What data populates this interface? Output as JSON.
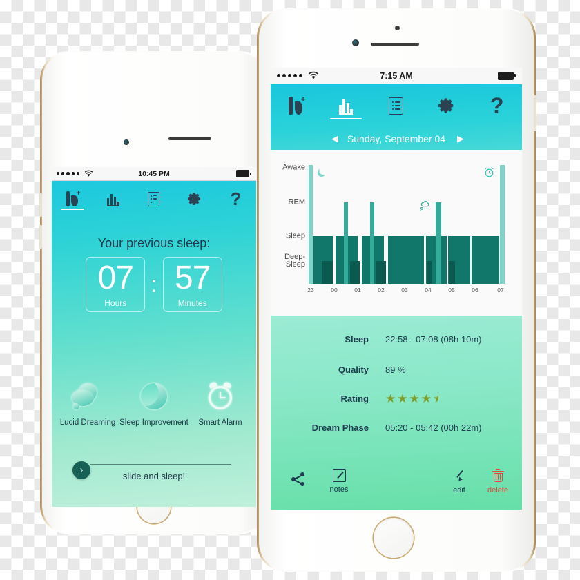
{
  "left_phone": {
    "status_bar": {
      "signal_dots": 5,
      "wifi": "wifi-icon",
      "time": "10:45 PM",
      "battery": "battery-full-icon"
    },
    "tabs": [
      {
        "id": "home",
        "icon": "b-plus-logo-icon",
        "active": true
      },
      {
        "id": "stats",
        "icon": "bar-chart-icon",
        "active": false
      },
      {
        "id": "list",
        "icon": "list-icon",
        "active": false
      },
      {
        "id": "settings",
        "icon": "gear-icon",
        "active": false
      },
      {
        "id": "help",
        "icon": "question-mark-icon",
        "label": "?",
        "active": false
      }
    ],
    "title": "Your previous sleep:",
    "counters": {
      "hours_value": "07",
      "hours_label": "Hours",
      "separator": ":",
      "minutes_value": "57",
      "minutes_label": "Minutes"
    },
    "features": [
      {
        "icon": "thought-cloud-icon",
        "label": "Lucid Dreaming"
      },
      {
        "icon": "moon-icon",
        "label": "Sleep Improvement"
      },
      {
        "icon": "alarm-clock-icon",
        "label": "Smart Alarm"
      }
    ],
    "slider": {
      "handle_glyph": "›",
      "label": "slide and sleep!"
    }
  },
  "right_phone": {
    "status_bar": {
      "signal_dots": 5,
      "wifi": "wifi-icon",
      "time": "7:15 AM",
      "battery": "battery-full-icon"
    },
    "tabs": [
      {
        "id": "home",
        "icon": "b-plus-logo-icon",
        "active": false
      },
      {
        "id": "stats",
        "icon": "bar-chart-icon",
        "active": true
      },
      {
        "id": "list",
        "icon": "list-icon",
        "active": false
      },
      {
        "id": "settings",
        "icon": "gear-icon",
        "active": false
      },
      {
        "id": "help",
        "icon": "question-mark-icon",
        "label": "?",
        "active": false
      }
    ],
    "date_bar": {
      "prev": "◀",
      "date": "Sunday, September 04",
      "next": "▶"
    },
    "stats": [
      {
        "key": "Sleep",
        "value": "22:58 - 07:08  (08h 10m)"
      },
      {
        "key": "Quality",
        "value": "89 %"
      },
      {
        "key": "Rating",
        "value": "",
        "rating_full": 4,
        "rating_half": true
      },
      {
        "key": "Dream Phase",
        "value": "05:20 - 05:42  (00h 22m)"
      }
    ],
    "toolbar": [
      {
        "id": "share",
        "icon": "share-icon",
        "label": ""
      },
      {
        "id": "notes",
        "icon": "note-edit-icon",
        "label": "notes"
      },
      {
        "id": "edit",
        "icon": "pencil-icon",
        "label": "edit"
      },
      {
        "id": "delete",
        "icon": "trash-icon",
        "label": "delete"
      }
    ]
  },
  "chart_data": {
    "type": "bar",
    "title": "",
    "xlabel": "",
    "ylabel": "",
    "legend_position": "none",
    "grid": false,
    "y_categories": [
      "Awake",
      "REM",
      "Sleep",
      "Deep-\nSleep"
    ],
    "y_levels": {
      "Awake": 4,
      "REM": 3,
      "Sleep": 2,
      "Deep-Sleep": 1
    },
    "categories": [
      "23",
      "00",
      "01",
      "02",
      "03",
      "04",
      "05",
      "06",
      "07"
    ],
    "x_range": [
      "23:00",
      "07:30"
    ],
    "colors": {
      "awake": "#7ed4c8",
      "rem": "#34ab9b",
      "sleep": "#11776b",
      "deep": "#0b5a50",
      "card_bg": "#fafafa"
    },
    "annotations": [
      {
        "icon": "moon-icon",
        "at": "23:05",
        "level": "Awake",
        "meaning": "sleep start"
      },
      {
        "icon": "thought-cloud-icon",
        "at": "05:25",
        "level": "REM",
        "meaning": "dream phase"
      },
      {
        "icon": "alarm-clock-icon",
        "at": "07:10",
        "level": "Awake",
        "meaning": "smart alarm wake"
      }
    ],
    "segments": [
      {
        "start": 0.0,
        "width": 2.2,
        "level": "Awake",
        "phase": "awake"
      },
      {
        "start": 2.2,
        "width": 10.0,
        "level": "Sleep",
        "phase": "sleep"
      },
      {
        "start": 6.6,
        "width": 5.6,
        "level": "Deep-Sleep",
        "phase": "deep"
      },
      {
        "start": 13.5,
        "width": 11.0,
        "level": "Sleep",
        "phase": "sleep"
      },
      {
        "start": 17.6,
        "width": 2.2,
        "level": "REM",
        "phase": "rem"
      },
      {
        "start": 20.5,
        "width": 5.0,
        "level": "Deep-Sleep",
        "phase": "deep"
      },
      {
        "start": 26.5,
        "width": 11.0,
        "level": "Sleep",
        "phase": "sleep"
      },
      {
        "start": 30.5,
        "width": 2.2,
        "level": "REM",
        "phase": "rem"
      },
      {
        "start": 33.5,
        "width": 5.0,
        "level": "Deep-Sleep",
        "phase": "deep"
      },
      {
        "start": 39.5,
        "width": 18.0,
        "level": "Sleep",
        "phase": "sleep"
      },
      {
        "start": 58.5,
        "width": 10.5,
        "level": "Sleep",
        "phase": "sleep"
      },
      {
        "start": 58.8,
        "width": 2.6,
        "level": "Deep-Sleep",
        "phase": "deep"
      },
      {
        "start": 63.5,
        "width": 2.6,
        "level": "REM",
        "phase": "rem"
      },
      {
        "start": 69.5,
        "width": 11.0,
        "level": "Sleep",
        "phase": "sleep"
      },
      {
        "start": 69.8,
        "width": 3.4,
        "level": "Deep-Sleep",
        "phase": "deep"
      },
      {
        "start": 81.5,
        "width": 2.4,
        "level": "Awake",
        "phase": "awake"
      }
    ]
  }
}
